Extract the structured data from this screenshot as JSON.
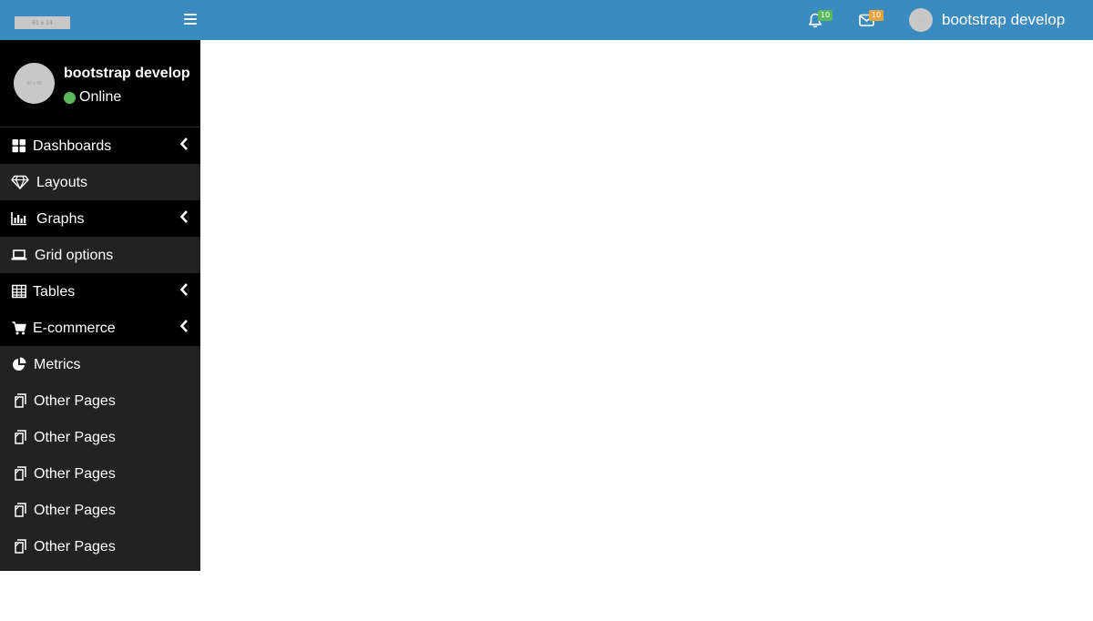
{
  "topbar": {
    "logo_text": "61 x 14",
    "notifications": {
      "icon": "bell-icon",
      "count": "10",
      "color": "#5cb85c"
    },
    "messages": {
      "icon": "envelope-icon",
      "count": "10",
      "color": "#e8a33d"
    },
    "user": {
      "avatar_text": "...",
      "name": "bootstrap develop"
    }
  },
  "sidebar": {
    "profile": {
      "avatar_text": "90 x 90",
      "name": "bootstrap develop",
      "status": "Online",
      "status_color": "#5cb85c"
    },
    "items": [
      {
        "label": "Dashboards",
        "icon": "dashboard-icon",
        "has_submenu": true
      },
      {
        "label": "Layouts",
        "icon": "diamond-icon",
        "has_submenu": false
      },
      {
        "label": "Graphs",
        "icon": "bar-chart-icon",
        "has_submenu": true
      },
      {
        "label": "Grid options",
        "icon": "laptop-icon",
        "has_submenu": false
      },
      {
        "label": "Tables",
        "icon": "table-icon",
        "has_submenu": true
      },
      {
        "label": "E-commerce",
        "icon": "cart-icon",
        "has_submenu": true
      },
      {
        "label": "Metrics",
        "icon": "pie-chart-icon",
        "has_submenu": false
      },
      {
        "label": "Other Pages",
        "icon": "files-icon",
        "has_submenu": false
      },
      {
        "label": "Other Pages",
        "icon": "files-icon",
        "has_submenu": false
      },
      {
        "label": "Other Pages",
        "icon": "files-icon",
        "has_submenu": false
      },
      {
        "label": "Other Pages",
        "icon": "files-icon",
        "has_submenu": false
      },
      {
        "label": "Other Pages",
        "icon": "files-icon",
        "has_submenu": false
      }
    ]
  },
  "colors": {
    "topbar": "#3a8bbf",
    "sidebar_dark": "#000000",
    "sidebar_gray": "#222222"
  }
}
